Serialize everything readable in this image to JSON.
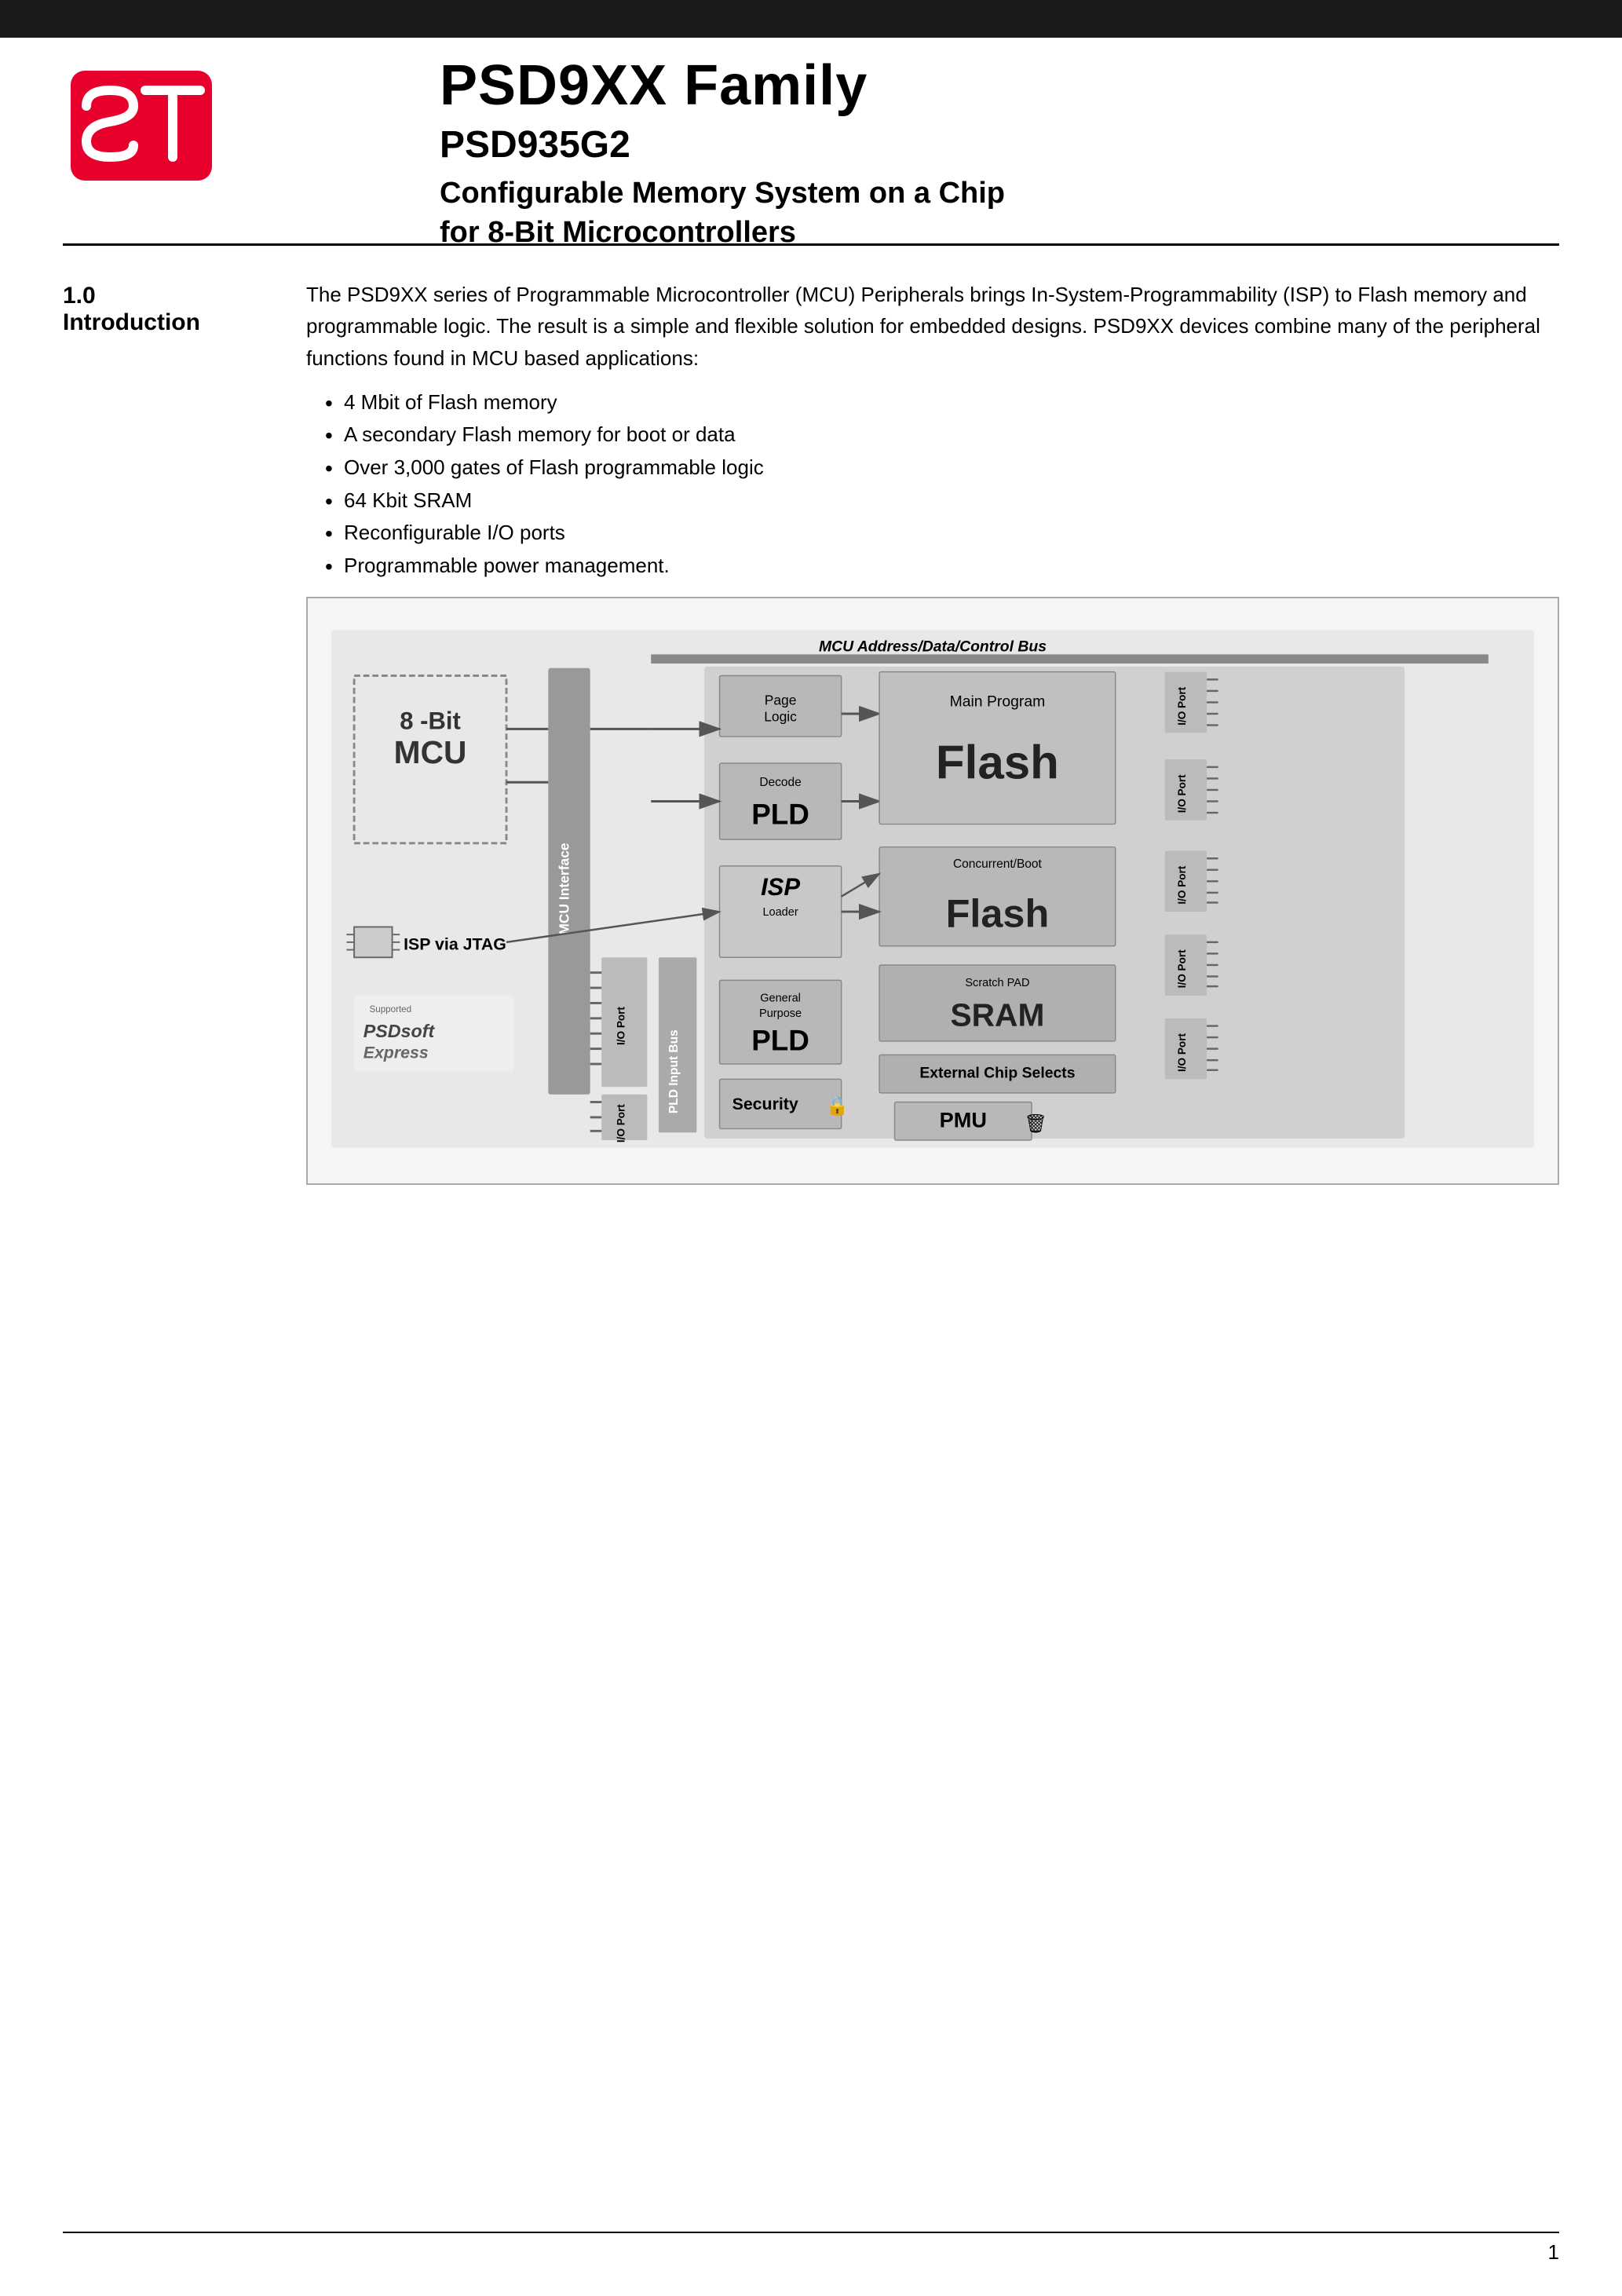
{
  "header": {
    "bar_color": "#1a1a1a"
  },
  "logo": {
    "alt": "ST logo"
  },
  "title": {
    "main": "PSD9XX Family",
    "sub": "PSD935G2",
    "desc_line1": "Configurable Memory System on a Chip",
    "desc_line2": "for 8-Bit Microcontrollers"
  },
  "section": {
    "number": "1.0",
    "name": "Introduction"
  },
  "intro_text": "The PSD9XX series of Programmable Microcontroller (MCU) Peripherals brings In-System-Programmability (ISP) to Flash memory and programmable logic. The result is a simple and flexible solution for embedded designs. PSD9XX devices combine many of the peripheral functions found in MCU based applications:",
  "bullets": [
    "4 Mbit of Flash memory",
    "A secondary Flash memory for boot or data",
    "Over 3,000 gates of Flash programmable logic",
    "64 Kbit SRAM",
    "Reconfigurable I/O ports",
    "Programmable power management."
  ],
  "diagram": {
    "title": "MCU Address/Data/Control Bus",
    "mcu_label": "8 -Bit\nMCU",
    "mcu_interface": "MCU Interface",
    "isp_jtag": "ISP via JTAG",
    "page_logic": "Page Logic",
    "decode": "Decode",
    "main_program": "Main Program",
    "flash_main": "Flash",
    "isp_label": "ISP",
    "loader": "Loader",
    "concurrent_boot": "Concurrent/Boot",
    "flash_boot": "Flash",
    "scratch_pad": "Scratch PAD",
    "sram": "SRAM",
    "pld_decode": "PLD",
    "general_purpose": "General Purpose",
    "pld_gp": "PLD",
    "external_chip": "External Chip Selects",
    "security": "Security",
    "pmu": "PMU",
    "pld_input_bus": "PLD Input Bus",
    "io_port": "I/O Port",
    "supported_by": "Supported by PSDsofEx",
    "io_ports_right": [
      "I/O Port",
      "I/O Port",
      "I/O Port",
      "I/O Port",
      "I/O Port"
    ],
    "io_ports_left": [
      "I/O Port",
      "I/O Port"
    ]
  },
  "footer": {
    "page_number": "1"
  }
}
